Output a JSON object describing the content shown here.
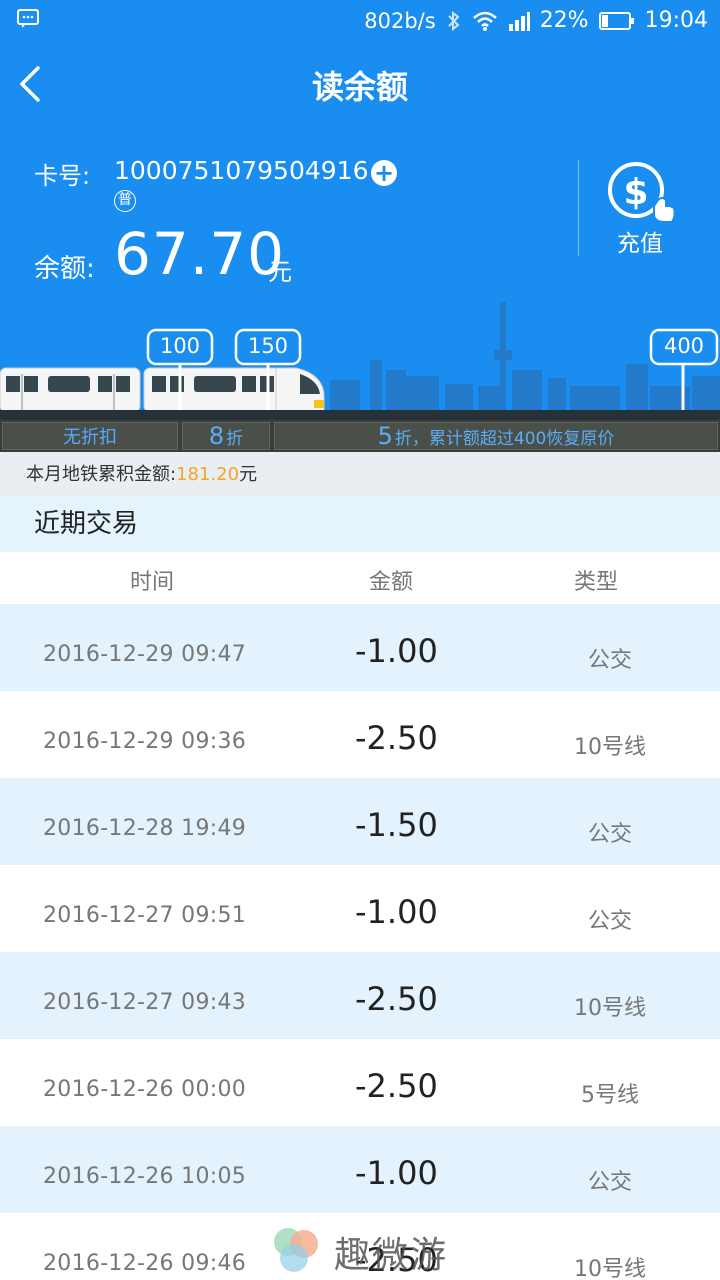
{
  "status_bar": {
    "speed": "802b/s",
    "battery": "22%",
    "time": "19:04"
  },
  "header": {
    "title": "读余额"
  },
  "card": {
    "number_label": "卡号:",
    "number": "1000751079504916",
    "type_badge": "普",
    "balance_label": "余额:",
    "balance": "67.70",
    "balance_unit": "元",
    "recharge_label": "充值"
  },
  "scene": {
    "marker_1": "100",
    "marker_2": "150",
    "marker_3": "400"
  },
  "tiers": {
    "t1": "无折扣",
    "t2_big": "8",
    "t2_small": "折",
    "t3_big": "5",
    "t3_small": "折，累计额超过400恢复原价"
  },
  "monthly": {
    "label": "本月地铁累积金额:",
    "amount": "181.20",
    "unit": "元"
  },
  "recent": {
    "title": "近期交易",
    "col_time": "时间",
    "col_amount": "金额",
    "col_type": "类型"
  },
  "transactions": [
    {
      "time": "2016-12-29  09:47",
      "amount": "-1.00",
      "type": "公交"
    },
    {
      "time": "2016-12-29  09:36",
      "amount": "-2.50",
      "type": "10号线"
    },
    {
      "time": "2016-12-28  19:49",
      "amount": "-1.50",
      "type": "公交"
    },
    {
      "time": "2016-12-27  09:51",
      "amount": "-1.00",
      "type": "公交"
    },
    {
      "time": "2016-12-27  09:43",
      "amount": "-2.50",
      "type": "10号线"
    },
    {
      "time": "2016-12-26  00:00",
      "amount": "-2.50",
      "type": "5号线"
    },
    {
      "time": "2016-12-26  10:05",
      "amount": "-1.00",
      "type": "公交"
    },
    {
      "time": "2016-12-26  09:46",
      "amount": "-2.50",
      "type": "10号线"
    }
  ],
  "watermark": {
    "text": "趣微游"
  },
  "colors": {
    "primary": "#1a8df0",
    "accent": "#f5a623",
    "row_alt": "#e3f2fc"
  }
}
